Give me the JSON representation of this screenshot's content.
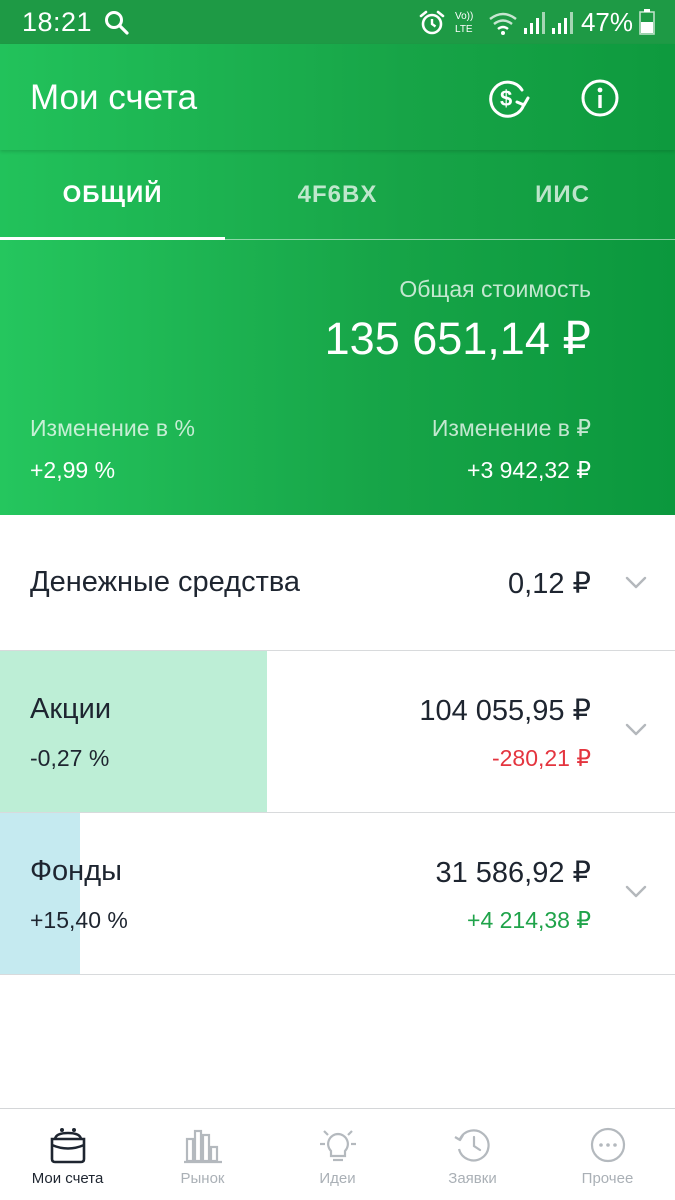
{
  "status_bar": {
    "time": "18:21",
    "battery": "47%"
  },
  "header": {
    "title": "Мои счета",
    "actions": [
      "currency-exchange-icon",
      "info-icon"
    ]
  },
  "tabs": [
    {
      "label": "ОБЩИЙ",
      "active": true
    },
    {
      "label": "4F6BX",
      "active": false
    },
    {
      "label": "ИИС",
      "active": false
    }
  ],
  "summary": {
    "total_label": "Общая стоимость",
    "total_value": "135 651,14 ₽",
    "change_pct_label": "Изменение в  %",
    "change_pct_value": "+2,99  %",
    "change_rub_label": "Изменение в ₽",
    "change_rub_value": "+3 942,32 ₽"
  },
  "portfolio": [
    {
      "name": "Денежные средства",
      "amount": "0,12 ₽"
    },
    {
      "name": "Акции",
      "pct": "-0,27  %",
      "amount": "104 055,95 ₽",
      "delta": "-280,21 ₽",
      "share": 0.396,
      "fill_color": "#bdeed6",
      "delta_color": "#e4353f"
    },
    {
      "name": "Фонды",
      "pct": "+15,40  %",
      "amount": "31 586,92 ₽",
      "delta": "+4 214,38 ₽",
      "share": 0.119,
      "fill_color": "#c5eaf0",
      "delta_color": "#1fa34a"
    }
  ],
  "bottom_nav": [
    {
      "label": "Мои счета",
      "icon": "wallet-icon",
      "active": true
    },
    {
      "label": "Рынок",
      "icon": "market-bars-icon",
      "active": false
    },
    {
      "label": "Идеи",
      "icon": "lightbulb-icon",
      "active": false
    },
    {
      "label": "Заявки",
      "icon": "history-clock-icon",
      "active": false
    },
    {
      "label": "Прочее",
      "icon": "more-dots-icon",
      "active": false
    }
  ],
  "colors": {
    "brand_green": "#1ea84c",
    "status_green": "#1e9a45",
    "negative": "#e4353f",
    "positive": "#1fa34a"
  }
}
